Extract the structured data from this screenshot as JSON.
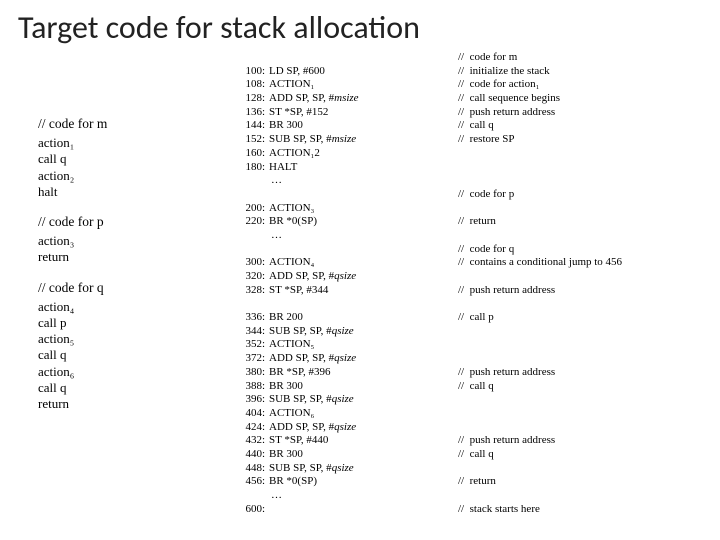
{
  "title": "Target code for stack allocation",
  "left_blocks": [
    {
      "comment": "// code for m",
      "lines": [
        "action₁",
        "call q",
        "action₂",
        "halt"
      ]
    },
    {
      "comment": "// code for p",
      "lines": [
        "action₃",
        "return"
      ]
    },
    {
      "comment": "// code for q",
      "lines": [
        "action₄",
        "call p",
        "action₅",
        "call q",
        "action₆",
        "call q",
        "return"
      ]
    }
  ],
  "code_lines": [
    {
      "addr": "",
      "instr": "",
      "comment": "//  code for m"
    },
    {
      "addr": "100:",
      "instr": "LD SP, #600",
      "comment": "//  initialize the stack"
    },
    {
      "addr": "108:",
      "instr": "ACTION₁",
      "comment": "//  code for action₁"
    },
    {
      "addr": "128:",
      "instr": "ADD SP, SP, #msize",
      "comment": "//  call sequence begins",
      "ital": true
    },
    {
      "addr": "136:",
      "instr": "ST *SP, #152",
      "comment": "//  push return address"
    },
    {
      "addr": "144:",
      "instr": "BR 300",
      "comment": "//  call q"
    },
    {
      "addr": "152:",
      "instr": "SUB SP, SP, #msize",
      "comment": "//  restore SP",
      "ital": true
    },
    {
      "addr": "160:",
      "instr": "ACTION₁2",
      "comment": ""
    },
    {
      "addr": "180:",
      "instr": "HALT",
      "comment": ""
    },
    {
      "addr": "",
      "instr": "…",
      "comment": "",
      "ellipsis": true
    },
    {
      "addr": "",
      "instr": "",
      "comment": "//  code for p"
    },
    {
      "addr": "200:",
      "instr": "ACTION₃",
      "comment": ""
    },
    {
      "addr": "220:",
      "instr": "BR *0(SP)",
      "comment": "//  return"
    },
    {
      "addr": "",
      "instr": "…",
      "comment": "",
      "ellipsis": true
    },
    {
      "addr": "",
      "instr": "",
      "comment": "//  code for q"
    },
    {
      "addr": "300:",
      "instr": "ACTION₄",
      "comment": "//  contains a conditional jump to 456"
    },
    {
      "addr": "320:",
      "instr": "ADD SP, SP, #qsize",
      "comment": "",
      "ital": true
    },
    {
      "addr": "328:",
      "instr": "ST *SP, #344",
      "comment": "//  push return address"
    },
    {
      "addr": "",
      "instr": "",
      "comment": ""
    },
    {
      "addr": "336:",
      "instr": "BR 200",
      "comment": "//  call p"
    },
    {
      "addr": "344:",
      "instr": "SUB SP, SP, #qsize",
      "comment": "",
      "ital": true
    },
    {
      "addr": "352:",
      "instr": "ACTION₅",
      "comment": ""
    },
    {
      "addr": "372:",
      "instr": "ADD SP, SP, #qsize",
      "comment": "",
      "ital": true
    },
    {
      "addr": "380:",
      "instr": "BR *SP, #396",
      "comment": "//  push return address"
    },
    {
      "addr": "388:",
      "instr": "BR 300",
      "comment": "//  call q"
    },
    {
      "addr": "396:",
      "instr": "SUB SP, SP, #qsize",
      "comment": "",
      "ital": true
    },
    {
      "addr": "404:",
      "instr": "ACTION₆",
      "comment": ""
    },
    {
      "addr": "424:",
      "instr": "ADD SP, SP, #qsize",
      "comment": "",
      "ital": true
    },
    {
      "addr": "432:",
      "instr": "ST *SP, #440",
      "comment": "//  push return address"
    },
    {
      "addr": "440:",
      "instr": "BR 300",
      "comment": "//  call q"
    },
    {
      "addr": "448:",
      "instr": "SUB SP, SP, #qsize",
      "comment": "",
      "ital": true
    },
    {
      "addr": "456:",
      "instr": "BR *0(SP)",
      "comment": "//  return"
    },
    {
      "addr": "",
      "instr": "…",
      "comment": "",
      "ellipsis": true
    },
    {
      "addr": "600:",
      "instr": "",
      "comment": "//  stack starts here"
    }
  ]
}
